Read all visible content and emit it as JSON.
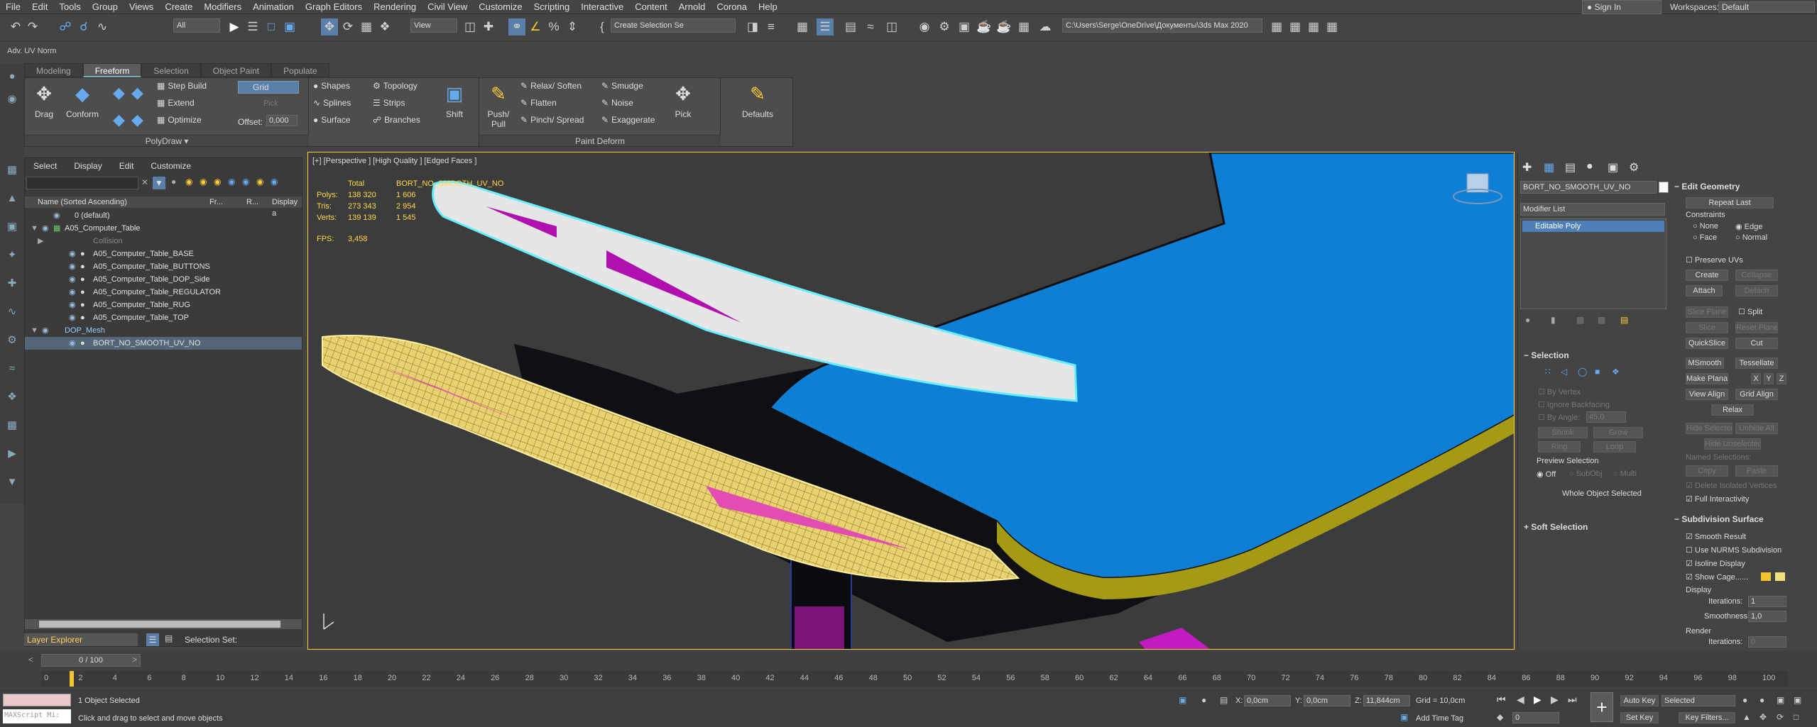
{
  "menu": [
    "File",
    "Edit",
    "Tools",
    "Group",
    "Views",
    "Create",
    "Modifiers",
    "Animation",
    "Graph Editors",
    "Rendering",
    "Civil View",
    "Customize",
    "Scripting",
    "Interactive",
    "Content",
    "Arnold",
    "Corona",
    "Help"
  ],
  "account": {
    "sign_in": "Sign In",
    "workspaces_label": "Workspaces:",
    "workspace_value": "Default"
  },
  "toolbar": {
    "filter_value": "All",
    "view_value": "View",
    "create_selection_set": "Create Selection Se",
    "project_path": "C:\\Users\\Serge\\OneDrive\\Документы\\3ds Max 2020"
  },
  "subbar_label": "Adv. UV Norm",
  "ribbon": {
    "tabs": [
      "Modeling",
      "Freeform",
      "Selection",
      "Object Paint",
      "Populate"
    ],
    "active_tab": "Freeform",
    "drag": "Drag",
    "conform": "Conform",
    "step_build": "Step Build",
    "extend": "Extend",
    "optimize": "Optimize",
    "grid_value": "Grid",
    "pick": "Pick",
    "offset_label": "Offset:",
    "offset_value": "0,000",
    "shapes": "Shapes",
    "splines": "Splines",
    "surface": "Surface",
    "topology": "Topology",
    "strips": "Strips",
    "branches": "Branches",
    "polydraw_footer": "PolyDraw",
    "shift": "Shift",
    "push_pull": "Push/\nPull",
    "relax_soften": "Relax/ Soften",
    "flatten": "Flatten",
    "pinch_spread": "Pinch/ Spread",
    "smudge": "Smudge",
    "noise": "Noise",
    "exaggerate": "Exaggerate",
    "pick2": "Pick",
    "paint_deform_footer": "Paint Deform",
    "defaults": "Defaults"
  },
  "scene_explorer": {
    "tabs": [
      "Select",
      "Display",
      "Edit",
      "Customize"
    ],
    "col_name": "Name (Sorted Ascending)",
    "col_fr": "Fr...",
    "col_r": "R...",
    "col_display": "Display a",
    "rows": [
      {
        "label": "0 (default)",
        "indent": 0
      },
      {
        "label": "A05_Computer_Table",
        "indent": 1
      },
      {
        "label": "Collision",
        "indent": 2
      },
      {
        "label": "A05_Computer_Table_BASE",
        "indent": 2
      },
      {
        "label": "A05_Computer_Table_BUTTONS",
        "indent": 2
      },
      {
        "label": "A05_Computer_Table_DOP_Side",
        "indent": 2
      },
      {
        "label": "A05_Computer_Table_REGULATOR",
        "indent": 2
      },
      {
        "label": "A05_Computer_Table_RUG",
        "indent": 2
      },
      {
        "label": "A05_Computer_Table_TOP",
        "indent": 2
      },
      {
        "label": "DOP_Mesh",
        "indent": 1
      },
      {
        "label": "BORT_NO_SMOOTH_UV_NO",
        "indent": 2
      }
    ],
    "layer_explorer": "Layer Explorer",
    "selection_set": "Selection Set:"
  },
  "viewport": {
    "label": "[+] [Perspective ] [High Quality ] [Edged Faces ]",
    "stats_total": "Total",
    "stats_object": "BORT_NO_SMOOTH_UV_NO",
    "polys_label": "Polys:",
    "polys_total": "138 320",
    "polys_obj": "1 606",
    "tris_label": "Tris:",
    "tris_total": "273 343",
    "tris_obj": "2 954",
    "verts_label": "Verts:",
    "verts_total": "139 139",
    "verts_obj": "1 545",
    "fps_label": "FPS:",
    "fps_value": "3,458"
  },
  "command_panel": {
    "object_name": "BORT_NO_SMOOTH_UV_NO",
    "modifier_list": "Modifier List",
    "stack_item": "Editable Poly",
    "selection_title": "Selection",
    "by_vertex": "By Vertex",
    "ignore_backfacing": "Ignore Backfacing",
    "by_angle": "By Angle:",
    "by_angle_value": "45,0",
    "shrink": "Shrink",
    "grow": "Grow",
    "ring": "Ring",
    "loop": "Loop",
    "preview_selection": "Preview Selection",
    "off": "Off",
    "subobj": "SubObj",
    "multi": "Multi",
    "whole_object_selected": "Whole Object Selected",
    "soft_selection": "Soft Selection",
    "edit_geometry_title": "Edit Geometry",
    "repeat_last": "Repeat Last",
    "constraints": "Constraints",
    "none": "None",
    "edge": "Edge",
    "face": "Face",
    "normal": "Normal",
    "preserve_uvs": "Preserve UVs",
    "create": "Create",
    "collapse": "Collapse",
    "attach": "Attach",
    "detach": "Detach",
    "slice_plane": "Slice Plane",
    "split": "Split",
    "slice": "Slice",
    "reset_plane": "Reset Plane",
    "quickslice": "QuickSlice",
    "cut": "Cut",
    "msmooth": "MSmooth",
    "tessellate": "Tessellate",
    "make_planar": "Make Planar",
    "x": "X",
    "y": "Y",
    "z": "Z",
    "view_align": "View Align",
    "grid_align": "Grid Align",
    "relax": "Relax",
    "hide_selected": "Hide Selected",
    "unhide_all": "Unhide All",
    "hide_unselected": "Hide Unselected",
    "named_selections": "Named Selections:",
    "copy": "Copy",
    "paste": "Paste",
    "delete_isolated": "Delete Isolated Vertices",
    "full_interactivity": "Full Interactivity",
    "subdivision_surface": "Subdivision Surface",
    "smooth_result": "Smooth Result",
    "use_nurms": "Use NURMS Subdivision",
    "isoline_display": "Isoline Display",
    "show_cage": "Show Cage......",
    "display": "Display",
    "iterations_label": "Iterations:",
    "iterations_value": "1",
    "smoothness_label": "Smoothness:",
    "smoothness_value": "1,0",
    "render": "Render",
    "render_iterations_value": "0"
  },
  "timeline": {
    "slider": "0 / 100",
    "ticks": [
      "0",
      "2",
      "4",
      "6",
      "8",
      "10",
      "12",
      "14",
      "16",
      "18",
      "20",
      "22",
      "24",
      "26",
      "28",
      "30",
      "32",
      "34",
      "36",
      "38",
      "40",
      "42",
      "44",
      "46",
      "48",
      "50",
      "52",
      "54",
      "56",
      "58",
      "60",
      "62",
      "64",
      "66",
      "68",
      "70",
      "72",
      "74",
      "76",
      "78",
      "80",
      "82",
      "84",
      "86",
      "88",
      "90",
      "92",
      "94",
      "96",
      "98",
      "100"
    ]
  },
  "status": {
    "maxscript": "MAXScript Mi:",
    "objects_selected": "1 Object Selected",
    "hint": "Click and drag to select and move objects",
    "x_label": "X:",
    "x_value": "0,0cm",
    "y_label": "Y:",
    "y_value": "0,0cm",
    "z_label": "Z:",
    "z_value": "11,844cm",
    "grid": "Grid = 10,0cm",
    "add_time_tag": "Add Time Tag",
    "auto_key": "Auto Key",
    "selected": "Selected",
    "set_key": "Set Key",
    "key_filters": "Key Filters...",
    "frame_value": "0"
  },
  "colors": {
    "accent": "#5a7fa8",
    "selection_yellow": "#ffcc33",
    "table_blue": "#0f7fd6",
    "magenta": "#c21bc2"
  }
}
